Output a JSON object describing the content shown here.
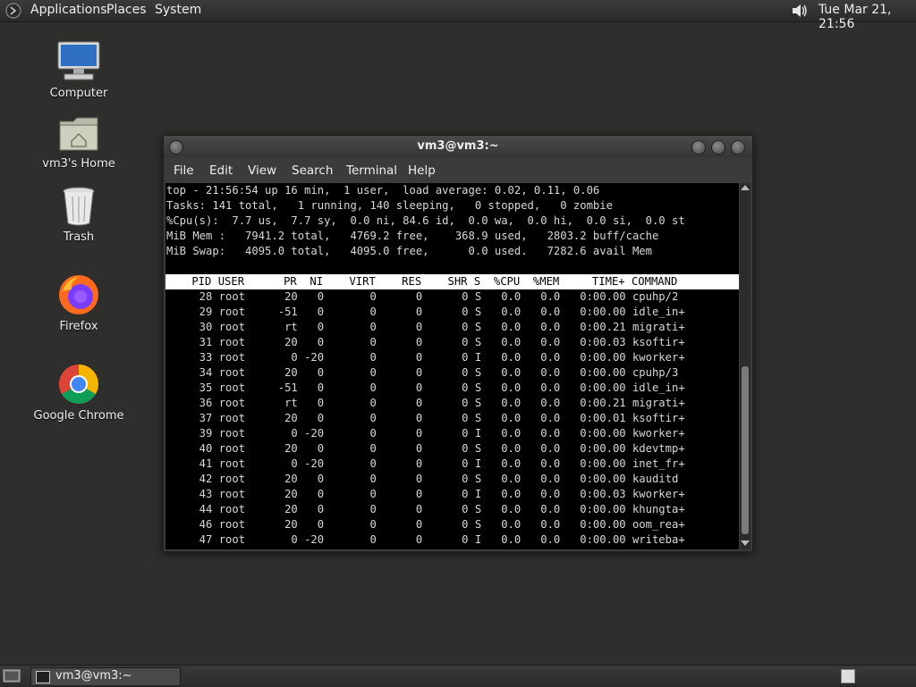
{
  "top_panel": {
    "menus": [
      "Applications",
      "Places",
      "System"
    ],
    "clock": "Tue Mar 21, 21:56"
  },
  "desktop_icons": [
    {
      "label": "Computer",
      "icon": "computer-icon"
    },
    {
      "label": "vm3's Home",
      "icon": "home-folder-icon"
    },
    {
      "label": "Trash",
      "icon": "trash-icon"
    },
    {
      "label": "Firefox",
      "icon": "firefox-icon"
    },
    {
      "label": "Google Chrome",
      "icon": "chrome-icon"
    }
  ],
  "terminal": {
    "title": "vm3@vm3:~",
    "menus": [
      "File",
      "Edit",
      "View",
      "Search",
      "Terminal",
      "Help"
    ],
    "summary": [
      "top - 21:56:54 up 16 min,  1 user,  load average: 0.02, 0.11, 0.06",
      "Tasks: 141 total,   1 running, 140 sleeping,   0 stopped,   0 zombie",
      "%Cpu(s):  7.7 us,  7.7 sy,  0.0 ni, 84.6 id,  0.0 wa,  0.0 hi,  0.0 si,  0.0 st",
      "MiB Mem :   7941.2 total,   4769.2 free,    368.9 used,   2803.2 buff/cache",
      "MiB Swap:   4095.0 total,   4095.0 free,      0.0 used.   7282.6 avail Mem"
    ],
    "process_header": "    PID USER      PR  NI    VIRT    RES    SHR S  %CPU  %MEM     TIME+ COMMAND",
    "processes": [
      "     28 root      20   0       0      0      0 S   0.0   0.0   0:00.00 cpuhp/2",
      "     29 root     -51   0       0      0      0 S   0.0   0.0   0:00.00 idle_in+",
      "     30 root      rt   0       0      0      0 S   0.0   0.0   0:00.21 migrati+",
      "     31 root      20   0       0      0      0 S   0.0   0.0   0:00.03 ksoftir+",
      "     33 root       0 -20       0      0      0 I   0.0   0.0   0:00.00 kworker+",
      "     34 root      20   0       0      0      0 S   0.0   0.0   0:00.00 cpuhp/3",
      "     35 root     -51   0       0      0      0 S   0.0   0.0   0:00.00 idle_in+",
      "     36 root      rt   0       0      0      0 S   0.0   0.0   0:00.21 migrati+",
      "     37 root      20   0       0      0      0 S   0.0   0.0   0:00.01 ksoftir+",
      "     39 root       0 -20       0      0      0 I   0.0   0.0   0:00.00 kworker+",
      "     40 root      20   0       0      0      0 S   0.0   0.0   0:00.00 kdevtmp+",
      "     41 root       0 -20       0      0      0 I   0.0   0.0   0:00.00 inet_fr+",
      "     42 root      20   0       0      0      0 S   0.0   0.0   0:00.00 kauditd",
      "     43 root      20   0       0      0      0 I   0.0   0.0   0:00.03 kworker+",
      "     44 root      20   0       0      0      0 S   0.0   0.0   0:00.00 khungta+",
      "     46 root      20   0       0      0      0 S   0.0   0.0   0:00.00 oom_rea+",
      "     47 root       0 -20       0      0      0 I   0.0   0.0   0:00.00 writeba+"
    ]
  },
  "bottom_panel": {
    "taskbar_item": "vm3@vm3:~"
  }
}
